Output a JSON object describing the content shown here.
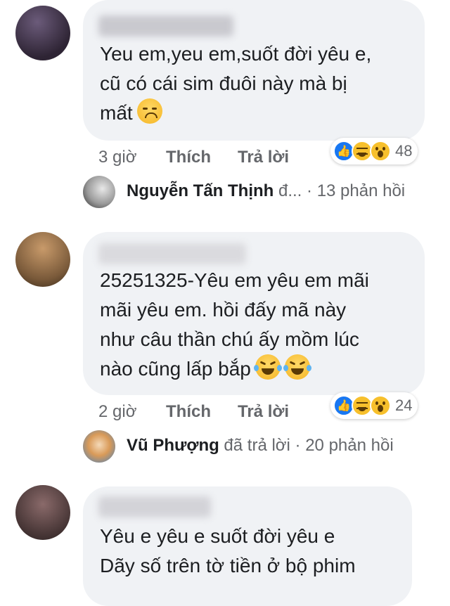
{
  "comments": [
    {
      "body": "Yeu em,yeu em,suốt đời yêu e,\ncũ có cái sim đuôi này mà bị\nmất",
      "emoji": "disappointed-face",
      "time": "3 giờ",
      "like_label": "Thích",
      "reply_label": "Trả lời",
      "reaction_icons": [
        "like-icon",
        "haha-icon",
        "wow-icon"
      ],
      "reaction_count": "48",
      "reply_summary": {
        "name": "Nguyễn Tấn Thịnh",
        "suffix": " đ...",
        "count": " · 13 phản hồi"
      }
    },
    {
      "body": "25251325-Yêu em yêu em mãi\nmãi yêu em. hồi đấy mã này\nnhư câu thần chú ấy mồm lúc\nnào cũng lấp bắp",
      "emoji": "tears-of-joy",
      "time": "2 giờ",
      "like_label": "Thích",
      "reply_label": "Trả lời",
      "reaction_icons": [
        "like-icon",
        "haha-icon",
        "wow-icon"
      ],
      "reaction_count": "24",
      "reply_summary": {
        "name": "Vũ Phượng",
        "suffix": " đã trả lời",
        "count": " · 20 phản hồi"
      }
    },
    {
      "body": "Yêu e yêu e suốt đời yêu e\nDãy số trên tờ tiền ở bộ phim"
    }
  ],
  "colors": {
    "bubble": "#f0f2f5",
    "meta_text": "#65676b",
    "like_blue": "#1877f2",
    "reaction_yellow": "#f7c02c"
  }
}
